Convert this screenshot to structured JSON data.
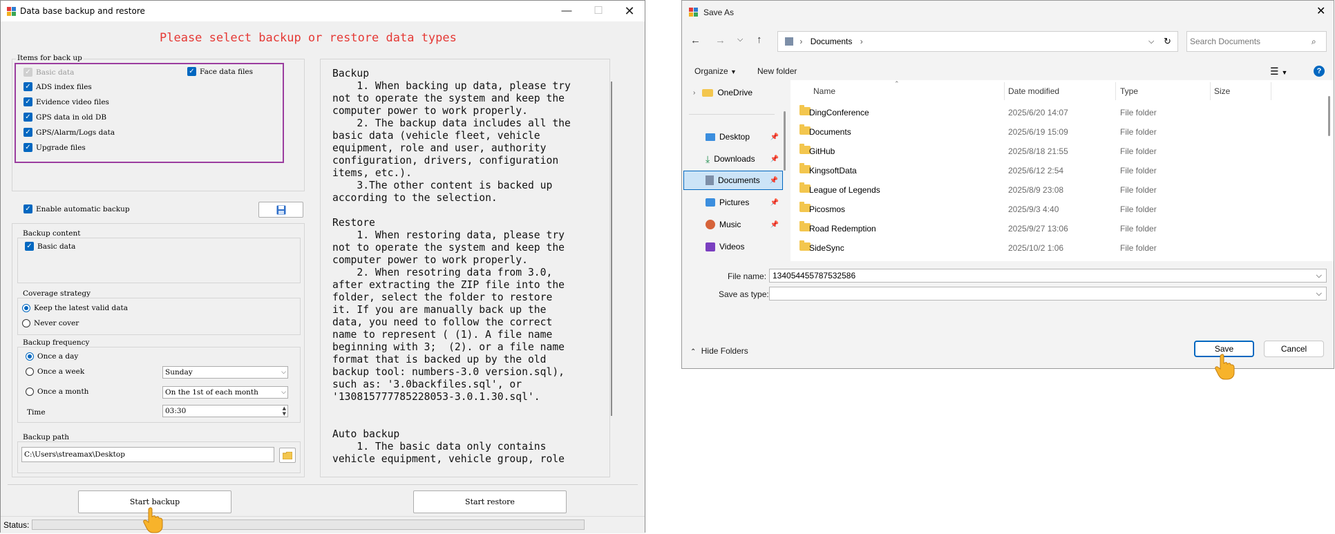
{
  "backup_window": {
    "title": "Data base backup and restore",
    "headline": "Please select backup or restore data types",
    "items_group_label": "Items for back up",
    "items": [
      {
        "label": "Basic data",
        "checked": true,
        "disabled": true
      },
      {
        "label": "Face data files",
        "checked": true
      },
      {
        "label": "ADS index files",
        "checked": true
      },
      {
        "label": "Evidence video files",
        "checked": true
      },
      {
        "label": "GPS data in old DB",
        "checked": true
      },
      {
        "label": "GPS/Alarm/Logs data",
        "checked": true
      },
      {
        "label": "Upgrade files",
        "checked": true
      }
    ],
    "auto_backup_label": "Enable automatic backup",
    "backup_content_label": "Backup content",
    "backup_content_basic": "Basic data",
    "coverage_label": "Coverage strategy",
    "coverage_keep": "Keep the latest valid data",
    "coverage_never": "Never cover",
    "frequency_label": "Backup frequency",
    "freq_day": "Once a day",
    "freq_week": "Once a week",
    "freq_month": "Once a month",
    "week_value": "Sunday",
    "month_value": "On the 1st of each month",
    "time_label": "Time",
    "time_value": "03:30",
    "path_label": "Backup path",
    "path_value": "C:\\Users\\streamax\\Desktop",
    "start_backup": "Start backup",
    "start_restore": "Start restore",
    "status_label": "Status:",
    "notes": "Backup\n    1. When backing up data, please try\nnot to operate the system and keep the\ncomputer power to work properly.\n    2. The backup data includes all the\nbasic data (vehicle fleet, vehicle\nequipment, role and user, authority\nconfiguration, drivers, configuration\nitems, etc.).\n    3.The other content is backed up\naccording to the selection.\n\nRestore\n    1. When restoring data, please try\nnot to operate the system and keep the\ncomputer power to work properly.\n    2. When resotring data from 3.0,\nafter extracting the ZIP file into the\nfolder, select the folder to restore\nit. If you are manually back up the\ndata, you need to follow the correct\nname to represent ( (1). A file name\nbeginning with 3;  (2). or a file name\nformat that is backed up by the old\nbackup tool: numbers-3.0 version.sql),\nsuch as: '3.0backfiles.sql', or\n'130815777785228053-3.0.1.30.sql'.\n\n\nAuto backup\n    1. The basic data only contains\nvehicle equipment, vehicle group, role"
  },
  "save_dialog": {
    "title": "Save As",
    "breadcrumb": "Documents",
    "search_placeholder": "Search Documents",
    "organize": "Organize",
    "new_folder": "New folder",
    "nav": [
      {
        "label": "OneDrive",
        "icon": "onedrive-icon"
      },
      {
        "label": "Desktop",
        "icon": "desktop-icon"
      },
      {
        "label": "Downloads",
        "icon": "downloads-icon"
      },
      {
        "label": "Documents",
        "icon": "documents-icon"
      },
      {
        "label": "Pictures",
        "icon": "pictures-icon"
      },
      {
        "label": "Music",
        "icon": "music-icon"
      },
      {
        "label": "Videos",
        "icon": "videos-icon"
      }
    ],
    "columns": {
      "name": "Name",
      "date": "Date modified",
      "type": "Type",
      "size": "Size"
    },
    "files": [
      {
        "name": "DingConference",
        "date": "2025/6/20 14:07",
        "type": "File folder"
      },
      {
        "name": "Documents",
        "date": "2025/6/19 15:09",
        "type": "File folder"
      },
      {
        "name": "GitHub",
        "date": "2025/8/18 21:55",
        "type": "File folder"
      },
      {
        "name": "KingsoftData",
        "date": "2025/6/12 2:54",
        "type": "File folder"
      },
      {
        "name": "League of Legends",
        "date": "2025/8/9 23:08",
        "type": "File folder"
      },
      {
        "name": "Picosmos",
        "date": "2025/9/3 4:40",
        "type": "File folder"
      },
      {
        "name": "Road Redemption",
        "date": "2025/9/27 13:06",
        "type": "File folder"
      },
      {
        "name": "SideSync",
        "date": "2025/10/2 1:06",
        "type": "File folder"
      }
    ],
    "file_name_label": "File name:",
    "file_name_value": "134054455787532586",
    "save_type_label": "Save as type:",
    "save_type_value": "",
    "hide_folders": "Hide Folders",
    "save": "Save",
    "cancel": "Cancel"
  },
  "colors": {
    "accent": "#0067c0",
    "headline": "#e53935",
    "highlight_border": "#9b3d9f",
    "folder": "#f3c64e"
  }
}
